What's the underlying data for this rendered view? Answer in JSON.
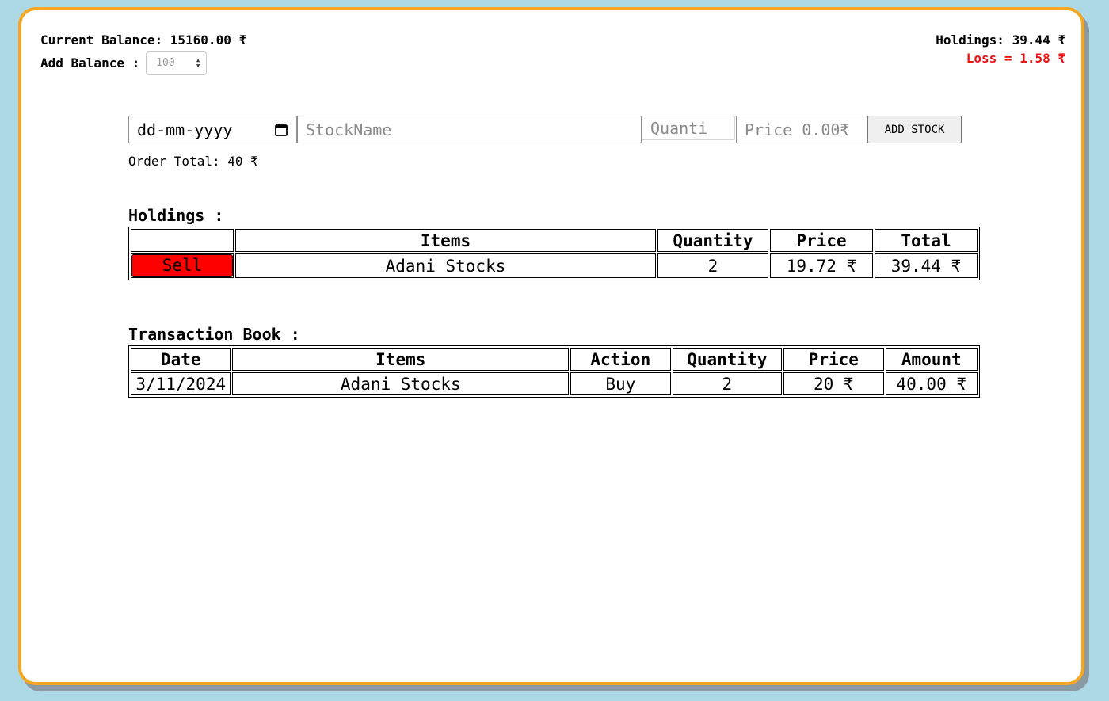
{
  "balance": {
    "current_label": "Current Balance:",
    "current_value": "15160.00 ₹",
    "add_label": "Add Balance :",
    "add_value": "100"
  },
  "summary": {
    "holdings_label": "Holdings:",
    "holdings_value": "39.44 ₹",
    "loss_text": "Loss = 1.58 ₹"
  },
  "order_form": {
    "date_placeholder": "dd-mm-yyyy",
    "stock_placeholder": "StockName",
    "quantity_placeholder": "Quanti",
    "price_placeholder": "Price 0.00₹",
    "add_button": "ADD STOCK",
    "order_total": "Order Total: 40 ₹"
  },
  "holdings": {
    "title": "Holdings :",
    "headers": [
      "",
      "Items",
      "Quantity",
      "Price",
      "Total"
    ],
    "rows": [
      {
        "action": "Sell",
        "item": "Adani Stocks",
        "quantity": "2",
        "price": "19.72 ₹",
        "total": "39.44 ₹"
      }
    ]
  },
  "transactions": {
    "title": "Transaction Book :",
    "headers": [
      "Date",
      "Items",
      "Action",
      "Quantity",
      "Price",
      "Amount"
    ],
    "rows": [
      {
        "date": "3/11/2024",
        "item": "Adani Stocks",
        "action": "Buy",
        "quantity": "2",
        "price": "20 ₹",
        "amount": "40.00 ₹"
      }
    ]
  },
  "colors": {
    "page_background": "#add8e6",
    "card_border": "#f5a623",
    "loss": "#ee1111",
    "sell_button": "#ff0000"
  }
}
